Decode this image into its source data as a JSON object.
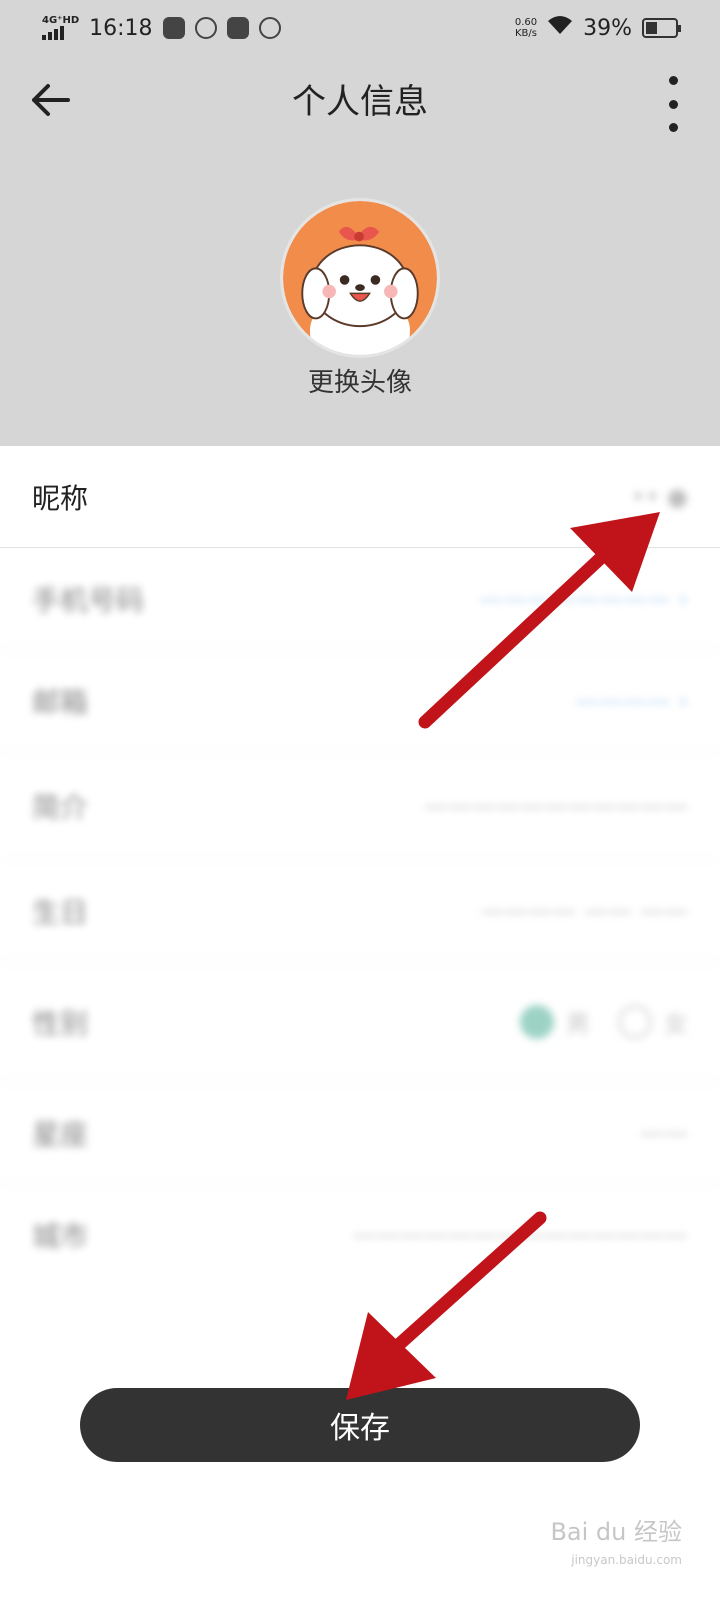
{
  "status_bar": {
    "network": "4G⁺HD",
    "time": "16:18",
    "speed_value": "0.60",
    "speed_unit": "KB/s",
    "battery": "39%",
    "battery_level": 0.39
  },
  "header": {
    "title": "个人信息",
    "avatar_label": "更换头像"
  },
  "form": {
    "rows": [
      {
        "label": "昵称",
        "value": "•• ●"
      },
      {
        "label": "手机号码",
        "value": "———————— ›"
      },
      {
        "label": "邮箱",
        "value": "———— ›"
      },
      {
        "label": "简介",
        "value": "———————————"
      },
      {
        "label": "生日",
        "value": "———— —— ——"
      },
      {
        "label": "性别",
        "option_1": "男",
        "option_2": "女"
      },
      {
        "label": "星座",
        "value": "——"
      },
      {
        "label": "城市",
        "value": "——————————————"
      }
    ]
  },
  "actions": {
    "save_label": "保存"
  },
  "watermark": {
    "brand": "Bai du 经验",
    "url": "jingyan.baidu.com"
  },
  "colors": {
    "header_bg": "#d6d6d6",
    "button_bg": "#333333",
    "arrow": "#c0141a",
    "radio_selected": "#4caf95"
  }
}
